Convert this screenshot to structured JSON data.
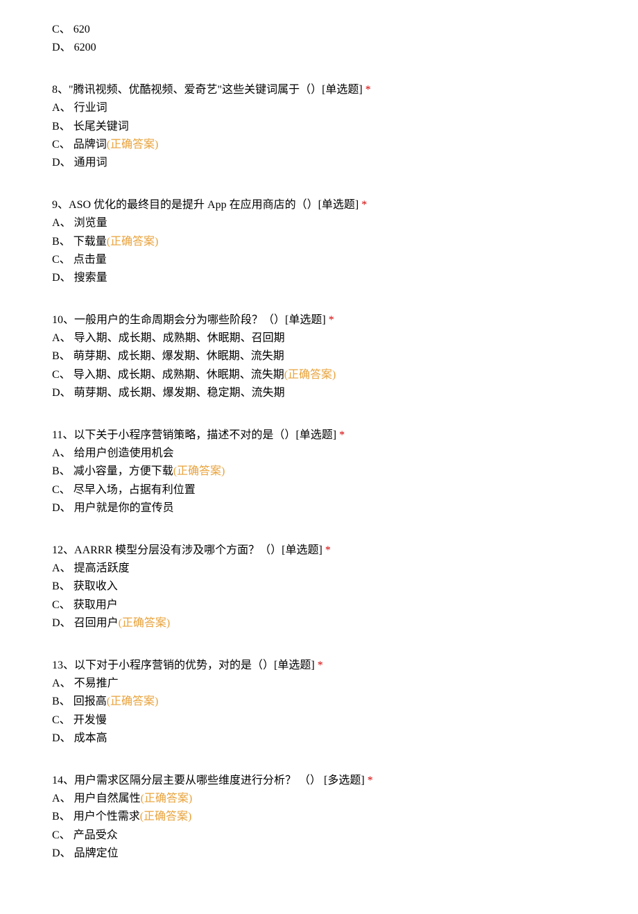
{
  "correct_label": "(正确答案)",
  "asterisk": "*",
  "questions": [
    {
      "stem_prefix": "",
      "stem": "",
      "type_tag": "",
      "show_asterisk": false,
      "options": [
        {
          "label": "C、",
          "text": "  620",
          "correct": false
        },
        {
          "label": "D、",
          "text": "  6200",
          "correct": false
        }
      ]
    },
    {
      "stem_prefix": "8、",
      "stem": "\"腾讯视频、优酷视频、爱奇艺\"这些关键词属于（）",
      "type_tag": "[单选题]",
      "show_asterisk": true,
      "options": [
        {
          "label": "A、",
          "text": "  行业词",
          "correct": false
        },
        {
          "label": "B、",
          "text": "  长尾关键词",
          "correct": false
        },
        {
          "label": "C、",
          "text": "  品牌词",
          "correct": true
        },
        {
          "label": "D、",
          "text": "  通用词",
          "correct": false
        }
      ]
    },
    {
      "stem_prefix": "9、",
      "stem": "ASO 优化的最终目的是提升 App 在应用商店的（）",
      "type_tag": "[单选题]",
      "show_asterisk": true,
      "options": [
        {
          "label": "A、",
          "text": "  浏览量",
          "correct": false
        },
        {
          "label": "B、",
          "text": "  下载量",
          "correct": true
        },
        {
          "label": "C、",
          "text": "  点击量",
          "correct": false
        },
        {
          "label": "D、",
          "text": "  搜索量",
          "correct": false
        }
      ]
    },
    {
      "stem_prefix": "10、",
      "stem": "一般用户的生命周期会分为哪些阶段？（）",
      "type_tag": "[单选题]",
      "show_asterisk": true,
      "options": [
        {
          "label": "A、",
          "text": "  导入期、成长期、成熟期、休眠期、召回期",
          "correct": false
        },
        {
          "label": "B、",
          "text": "  萌芽期、成长期、爆发期、休眠期、流失期",
          "correct": false
        },
        {
          "label": "C、",
          "text": "  导入期、成长期、成熟期、休眠期、流失期",
          "correct": true
        },
        {
          "label": "D、",
          "text": "  萌芽期、成长期、爆发期、稳定期、流失期",
          "correct": false
        }
      ]
    },
    {
      "stem_prefix": "11、",
      "stem": "以下关于小程序营销策略，描述不对的是（）",
      "type_tag": "[单选题]",
      "show_asterisk": true,
      "options": [
        {
          "label": "A、",
          "text": "  给用户创造使用机会",
          "correct": false
        },
        {
          "label": "B、",
          "text": "  减小容量，方便下载",
          "correct": true
        },
        {
          "label": "C、",
          "text": "  尽早入场，占据有利位置",
          "correct": false
        },
        {
          "label": "D、",
          "text": "  用户就是你的宣传员",
          "correct": false
        }
      ]
    },
    {
      "stem_prefix": "12、",
      "stem": "AARRR 模型分层没有涉及哪个方面？（）",
      "type_tag": "[单选题]",
      "show_asterisk": true,
      "options": [
        {
          "label": "A、",
          "text": "  提高活跃度",
          "correct": false
        },
        {
          "label": "B、",
          "text": "  获取收入",
          "correct": false
        },
        {
          "label": "C、",
          "text": "  获取用户",
          "correct": false
        },
        {
          "label": "D、",
          "text": "  召回用户",
          "correct": true
        }
      ]
    },
    {
      "stem_prefix": "13、",
      "stem": "以下对于小程序营销的优势，对的是（）",
      "type_tag": "[单选题]",
      "show_asterisk": true,
      "options": [
        {
          "label": "A、",
          "text": "  不易推广",
          "correct": false
        },
        {
          "label": "B、",
          "text": "  回报高",
          "correct": true
        },
        {
          "label": "C、",
          "text": "  开发慢",
          "correct": false
        },
        {
          "label": "D、",
          "text": "  成本高",
          "correct": false
        }
      ]
    },
    {
      "stem_prefix": "14、",
      "stem": "用户需求区隔分层主要从哪些维度进行分析？ （） ",
      "type_tag": "[多选题]",
      "show_asterisk": true,
      "options": [
        {
          "label": "A、",
          "text": "  用户自然属性",
          "correct": true
        },
        {
          "label": "B、",
          "text": "  用户个性需求",
          "correct": true
        },
        {
          "label": "C、",
          "text": "  产品受众",
          "correct": false
        },
        {
          "label": "D、",
          "text": "  品牌定位",
          "correct": false
        }
      ]
    }
  ]
}
